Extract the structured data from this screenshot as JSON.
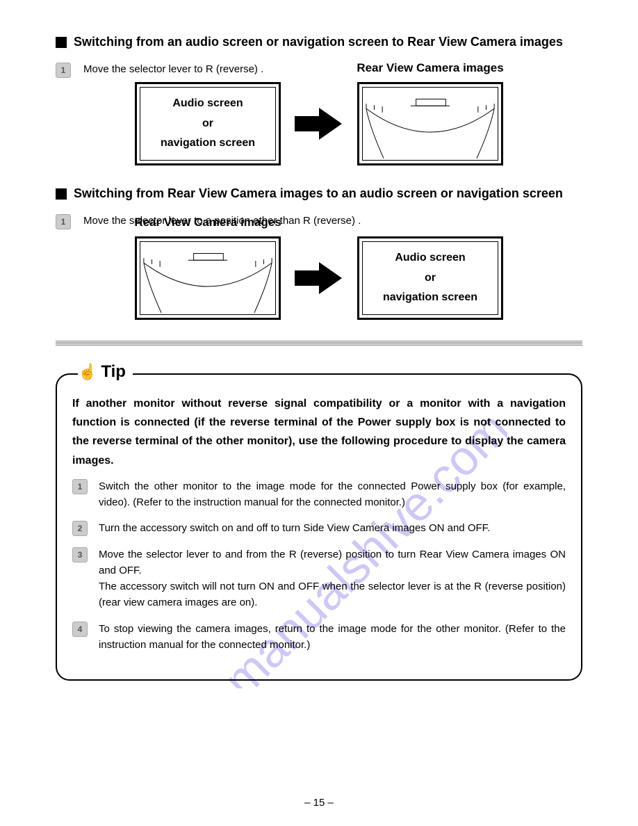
{
  "section1": {
    "heading": "Switching from an audio screen or navigation screen to Rear View Camera images",
    "step_num": "1",
    "step_text": "Move the selector lever to R (reverse) .",
    "left_box_l1": "Audio screen",
    "left_box_l2": "or",
    "left_box_l3": "navigation screen",
    "right_label": "Rear View Camera images"
  },
  "section2": {
    "heading": "Switching from Rear View Camera images to an audio screen or navigation screen",
    "step_num": "1",
    "step_text": "Move the selector lever to a position other than R (reverse) .",
    "left_label": "Rear View Camera images",
    "right_box_l1": "Audio screen",
    "right_box_l2": "or",
    "right_box_l3": "navigation screen"
  },
  "tip": {
    "label": "Tip",
    "intro": "If another monitor without reverse signal compatibility or a monitor with a navigation function is connected (if the reverse terminal of the Power supply box is not connected to the reverse terminal of the other monitor), use the following procedure to display the camera images.",
    "steps": [
      {
        "num": "1",
        "body": "Switch the other monitor to the image mode for the connected Power supply box (for example, video). (Refer to the instruction manual for the connected monitor.)"
      },
      {
        "num": "2",
        "body": "Turn the accessory switch on and off to turn Side View Camera images ON and OFF."
      },
      {
        "num": "3",
        "body": "Move the selector lever to and from the R (reverse) position to turn Rear View Camera images ON and OFF.\nThe accessory switch will not turn ON and OFF when the selector lever is at the R (reverse position) (rear view camera images are on)."
      },
      {
        "num": "4",
        "body": "To stop viewing the camera images, return to the image mode for the other monitor. (Refer to the instruction manual for the connected monitor.)"
      }
    ]
  },
  "page_number": "– 15 –",
  "watermark": "manualshive.com"
}
